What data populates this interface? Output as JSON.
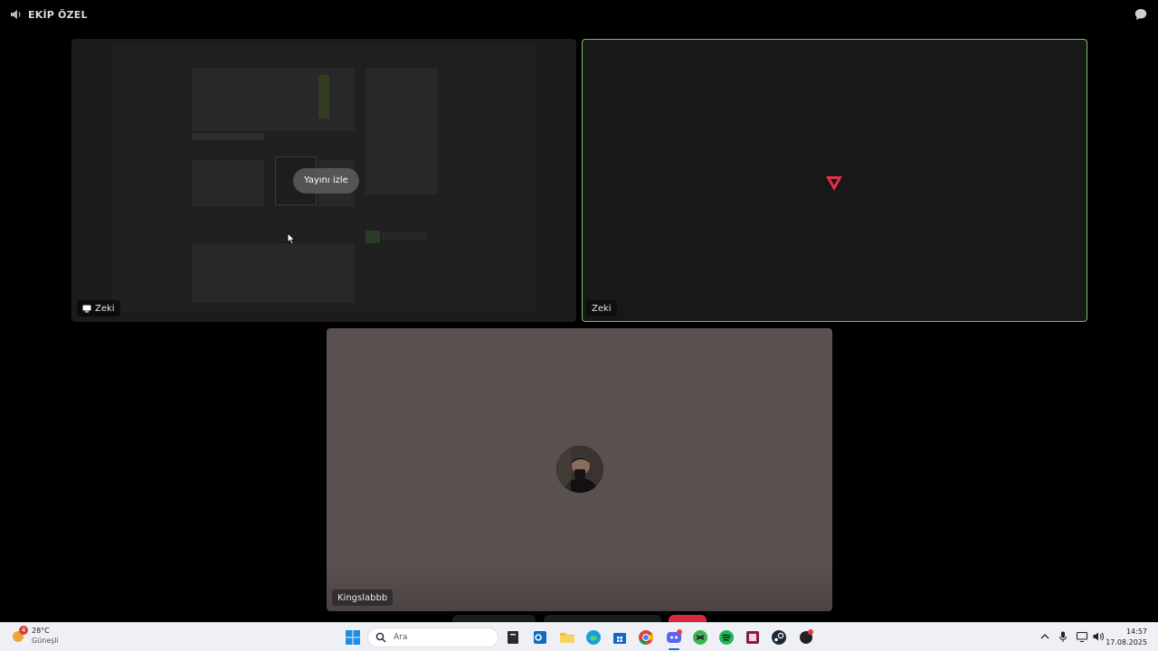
{
  "header": {
    "channel_name": "EKİP ÖZEL",
    "channel_icon": "speaker-icon",
    "chat_icon": "chat-bubble-icon"
  },
  "tiles": [
    {
      "kind": "screen-share",
      "name": "Zeki",
      "action_label": "Yayını izle",
      "badge_icon": "screen-share-icon"
    },
    {
      "kind": "camera-off",
      "name": "Zeki",
      "speaking": true,
      "activity_icon": "valorant-icon",
      "highlight_color": "#7dbf65"
    },
    {
      "kind": "avatar",
      "name": "Kingslabbb"
    }
  ],
  "taskbar": {
    "weather": {
      "temp": "28°C",
      "condition": "Güneşli",
      "badge": "4"
    },
    "search_placeholder": "Ara",
    "apps": [
      "start-icon",
      "search-icon",
      "file-icon",
      "outlook-icon",
      "explorer-icon",
      "edge-icon",
      "store-icon",
      "chrome-icon",
      "discord-icon",
      "xbox-app-icon",
      "spotify-icon",
      "app-icon",
      "steam-icon",
      "game-icon"
    ],
    "discord_badge": "4+",
    "tray": [
      "chevron-up-icon",
      "microphone-icon",
      "network-icon",
      "volume-icon"
    ],
    "time": "14:57",
    "date": "17.08.2025"
  },
  "colors": {
    "accent_speaking": "#7dbf65",
    "leave_button": "#d8293f",
    "taskbar": "#eef0f5"
  }
}
